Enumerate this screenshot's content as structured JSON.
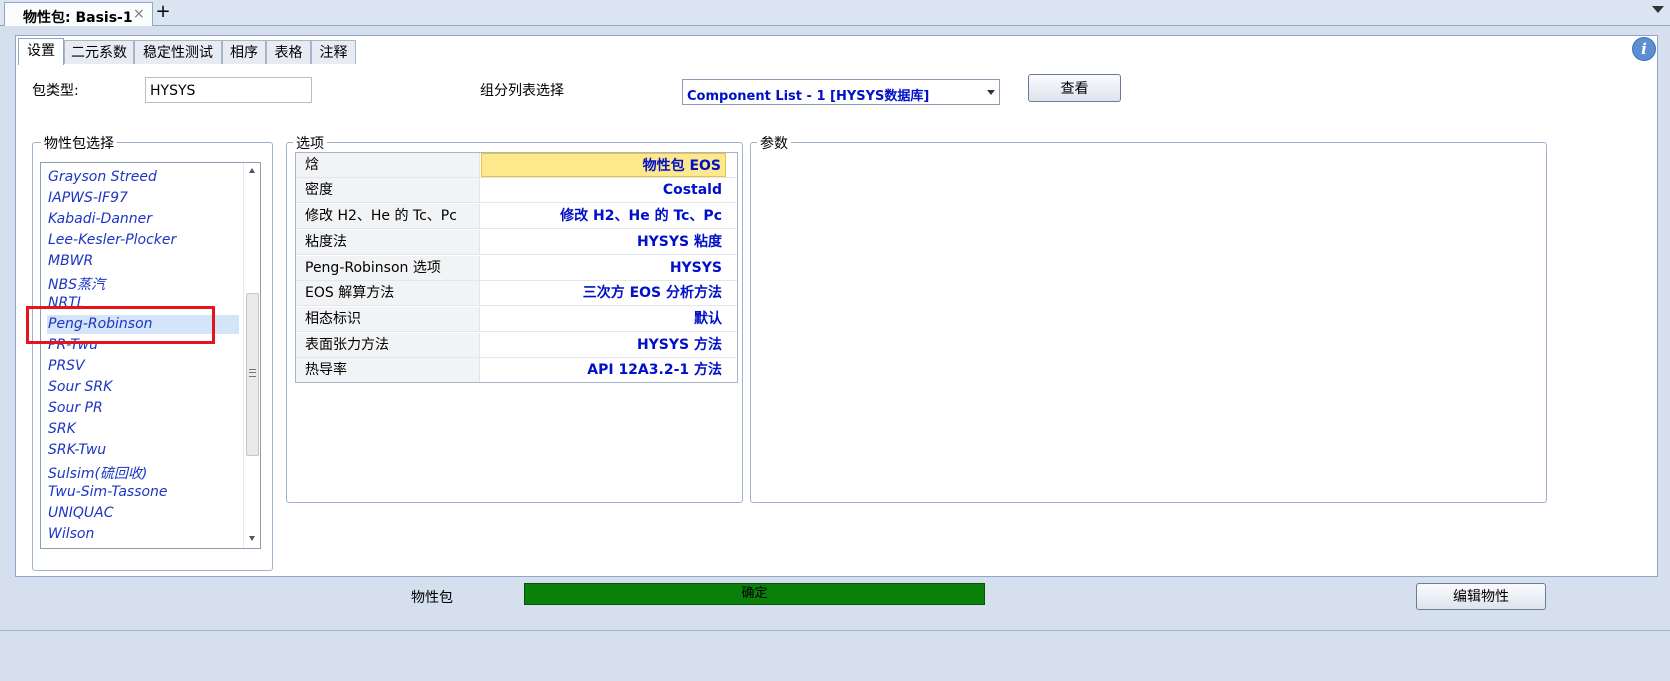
{
  "document_tab": {
    "label": "物性包: Basis-1",
    "close": "×",
    "add": "+"
  },
  "tabs": [
    "设置",
    "二元系数",
    "稳定性测试",
    "相序",
    "表格",
    "注释"
  ],
  "info_icon": "i",
  "setup": {
    "package_type_label": "包类型:",
    "package_type_value": "HYSYS",
    "component_list_label": "组分列表选择",
    "component_list_value": "Component List - 1 [HYSYS数据库]",
    "view_button": "查看"
  },
  "package_selection": {
    "title": "物性包选择",
    "items": [
      "Grayson Streed",
      "IAPWS-IF97",
      "Kabadi-Danner",
      "Lee-Kesler-Plocker",
      "MBWR",
      "NBS蒸汽",
      "NRTL",
      "Peng-Robinson",
      "PR-Twu",
      "PRSV",
      "Sour SRK",
      "Sour PR",
      "SRK",
      "SRK-Twu",
      "Sulsim(硫回收)",
      "Twu-Sim-Tassone",
      "UNIQUAC",
      "Wilson"
    ],
    "selected": "Peng-Robinson"
  },
  "options": {
    "title": "选项",
    "rows": [
      {
        "name": "焓",
        "value": "物性包 EOS"
      },
      {
        "name": "密度",
        "value": "Costald"
      },
      {
        "name": "修改 H2、He 的 Tc、Pc",
        "value": "修改 H2、He 的 Tc、Pc"
      },
      {
        "name": "粘度法",
        "value": "HYSYS 粘度"
      },
      {
        "name": "Peng-Robinson 选项",
        "value": "HYSYS"
      },
      {
        "name": "EOS 解算方法",
        "value": "三次方 EOS 分析方法"
      },
      {
        "name": "相态标识",
        "value": "默认"
      },
      {
        "name": "表面张力方法",
        "value": "HYSYS 方法"
      },
      {
        "name": "热导率",
        "value": "API 12A3.2-1 方法"
      }
    ]
  },
  "parameters": {
    "title": "参数"
  },
  "status": {
    "label": "物性包",
    "value": "确定",
    "color": "#0a7f0a"
  },
  "edit_button": "编辑物性"
}
